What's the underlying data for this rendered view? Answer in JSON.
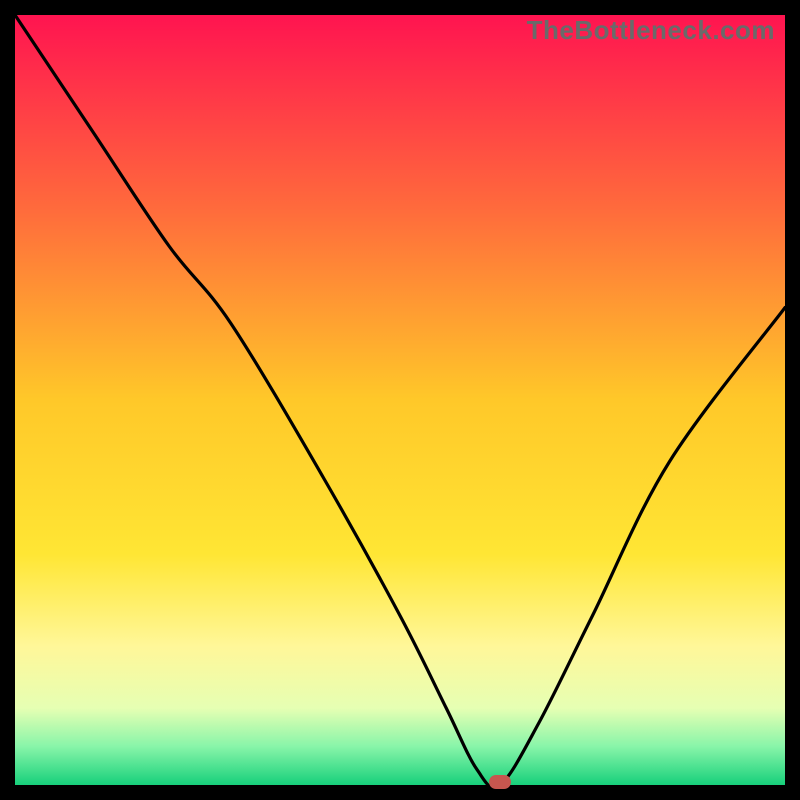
{
  "watermark": "TheBottleneck.com",
  "chart_data": {
    "type": "line",
    "title": "",
    "xlabel": "",
    "ylabel": "",
    "xlim": [
      0,
      100
    ],
    "ylim": [
      0,
      100
    ],
    "series": [
      {
        "name": "bottleneck-curve",
        "x": [
          0,
          10,
          20,
          28,
          40,
          50,
          56,
          60,
          63,
          68,
          75,
          85,
          100
        ],
        "y": [
          100,
          85,
          70,
          60,
          40,
          22,
          10,
          2,
          0,
          8,
          22,
          42,
          62
        ]
      }
    ],
    "marker": {
      "x": 63,
      "y": 0,
      "color": "#c6564f"
    },
    "gradient_stops": [
      {
        "pos": 0,
        "color": "#ff1450"
      },
      {
        "pos": 25,
        "color": "#ff6a3c"
      },
      {
        "pos": 50,
        "color": "#ffc829"
      },
      {
        "pos": 70,
        "color": "#ffe634"
      },
      {
        "pos": 82,
        "color": "#fff799"
      },
      {
        "pos": 90,
        "color": "#e6ffb3"
      },
      {
        "pos": 95,
        "color": "#88f5a9"
      },
      {
        "pos": 100,
        "color": "#17d07b"
      }
    ]
  }
}
